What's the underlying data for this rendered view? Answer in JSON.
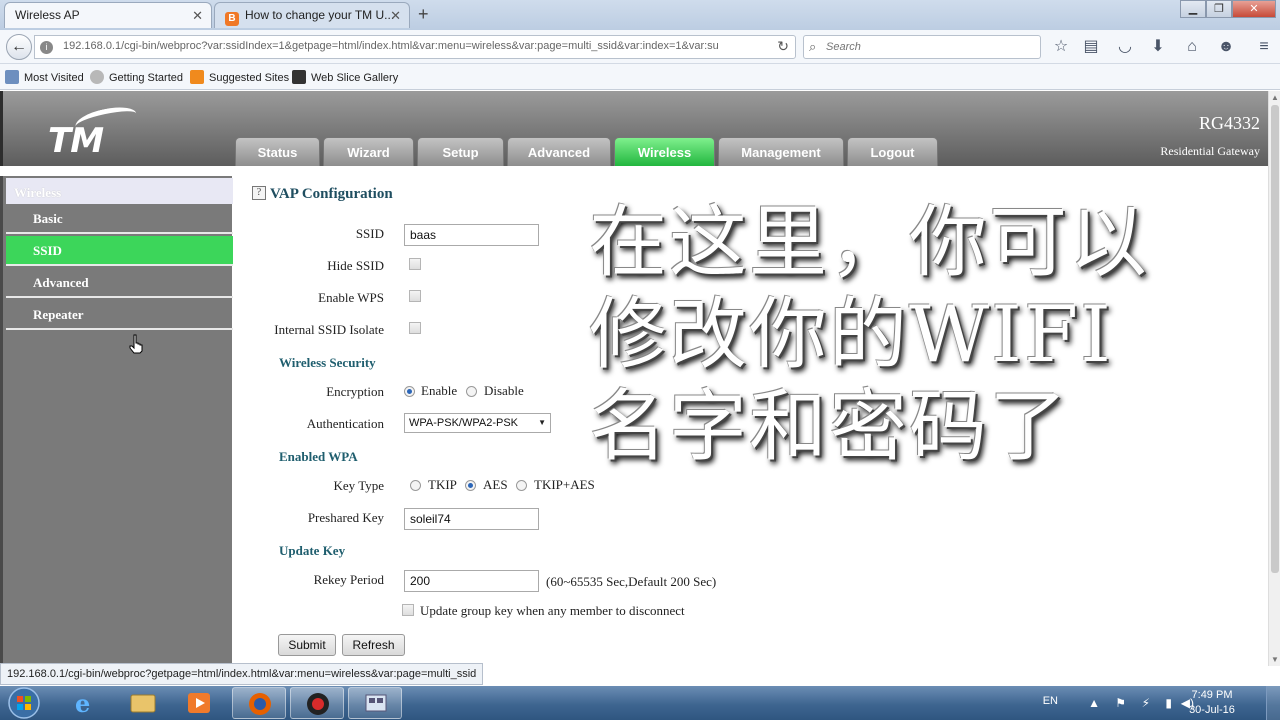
{
  "browser": {
    "tabs": [
      {
        "title": "Wireless AP",
        "active": true
      },
      {
        "title": "How to change your TM U...",
        "active": false
      }
    ],
    "new_tab_label": "+",
    "url": "192.168.0.1/cgi-bin/webproc?var:ssidIndex=1&getpage=html/index.html&var:menu=wireless&var:page=multi_ssid&var:index=1&var:su",
    "search_placeholder": "Search",
    "bookmarks": [
      "Most Visited",
      "Getting Started",
      "Suggested Sites",
      "Web Slice Gallery"
    ],
    "status_url": "192.168.0.1/cgi-bin/webproc?getpage=html/index.html&var:menu=wireless&var:page=multi_ssid"
  },
  "router": {
    "brand": "TM",
    "model": "RG4332",
    "model_sub": "Residential Gateway",
    "menu": [
      "Status",
      "Wizard",
      "Setup",
      "Advanced",
      "Wireless",
      "Management",
      "Logout"
    ],
    "active_menu": "Wireless",
    "sidebar": {
      "title": "Wireless",
      "items": [
        "Basic",
        "SSID",
        "Advanced",
        "Repeater"
      ],
      "active_item": "SSID"
    },
    "form": {
      "help_icon": "?",
      "title": "VAP Configuration",
      "ssid_label": "SSID",
      "ssid_value": "baas",
      "hide_ssid_label": "Hide SSID",
      "enable_wps_label": "Enable WPS",
      "isolate_label": "Internal SSID Isolate",
      "wireless_security_heading": "Wireless Security",
      "encryption_label": "Encryption",
      "encryption_options": [
        "Enable",
        "Disable"
      ],
      "encryption_selected": "Enable",
      "authentication_label": "Authentication",
      "authentication_value": "WPA-PSK/WPA2-PSK",
      "enabled_wpa_heading": "Enabled WPA",
      "key_type_label": "Key Type",
      "key_type_options": [
        "TKIP",
        "AES",
        "TKIP+AES"
      ],
      "key_type_selected": "AES",
      "preshared_key_label": "Preshared Key",
      "preshared_key_value": "soleil74",
      "update_key_heading": "Update Key",
      "rekey_period_label": "Rekey Period",
      "rekey_period_value": "200",
      "rekey_period_hint": "(60~65535 Sec,Default 200 Sec)",
      "update_group_key_label": "Update group key when any member to disconnect",
      "submit_label": "Submit",
      "refresh_label": "Refresh"
    },
    "overlay_text": "在这里，你可以\n修改你的WIFI\n名字和密码了"
  },
  "taskbar": {
    "language": "EN",
    "time": "7:49 PM",
    "date": "30-Jul-16",
    "apps": [
      "ie-icon",
      "explorer-icon",
      "media-player-icon",
      "firefox-icon",
      "recorder-icon",
      "network-tool-icon"
    ]
  },
  "colors": {
    "active_green": "#3cd65a",
    "header_gray": "#7a7a7a",
    "section_teal": "#1f5e6e",
    "taskbar_blue": "#3e6590"
  }
}
